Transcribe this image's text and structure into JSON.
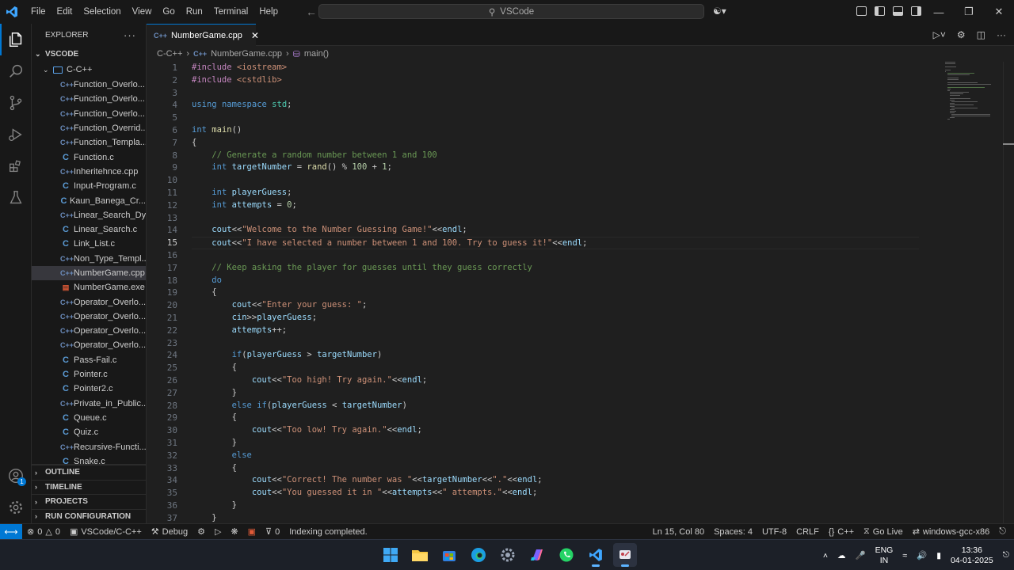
{
  "titlebar": {
    "menu": [
      "File",
      "Edit",
      "Selection",
      "View",
      "Go",
      "Run",
      "Terminal",
      "Help"
    ],
    "search_text": "VSCode"
  },
  "sidebar": {
    "title": "EXPLORER",
    "root": "VSCODE",
    "folder": "C-C++",
    "files": [
      {
        "icon": "cpp",
        "name": "Function_Overlo..."
      },
      {
        "icon": "cpp",
        "name": "Function_Overlo..."
      },
      {
        "icon": "cpp",
        "name": "Function_Overlo..."
      },
      {
        "icon": "cpp",
        "name": "Function_Overrid..."
      },
      {
        "icon": "cpp",
        "name": "Function_Templa..."
      },
      {
        "icon": "c",
        "name": "Function.c"
      },
      {
        "icon": "cpp",
        "name": "Inheritehnce.cpp"
      },
      {
        "icon": "c",
        "name": "Input-Program.c"
      },
      {
        "icon": "c",
        "name": "Kaun_Banega_Cr..."
      },
      {
        "icon": "cpp",
        "name": "Linear_Search_Dy..."
      },
      {
        "icon": "c",
        "name": "Linear_Search.c"
      },
      {
        "icon": "c",
        "name": "Link_List.c"
      },
      {
        "icon": "cpp",
        "name": "Non_Type_Templ..."
      },
      {
        "icon": "cpp",
        "name": "NumberGame.cpp",
        "selected": true
      },
      {
        "icon": "exe",
        "name": "NumberGame.exe"
      },
      {
        "icon": "cpp",
        "name": "Operator_Overlo..."
      },
      {
        "icon": "cpp",
        "name": "Operator_Overlo..."
      },
      {
        "icon": "cpp",
        "name": "Operator_Overlo..."
      },
      {
        "icon": "cpp",
        "name": "Operator_Overlo..."
      },
      {
        "icon": "c",
        "name": "Pass-Fail.c"
      },
      {
        "icon": "c",
        "name": "Pointer.c"
      },
      {
        "icon": "c",
        "name": "Pointer2.c"
      },
      {
        "icon": "cpp",
        "name": "Private_in_Public..."
      },
      {
        "icon": "c",
        "name": "Queue.c"
      },
      {
        "icon": "c",
        "name": "Quiz.c"
      },
      {
        "icon": "cpp",
        "name": "Recursive-Functi..."
      },
      {
        "icon": "c",
        "name": "Snake.c"
      }
    ],
    "sections": [
      "OUTLINE",
      "TIMELINE",
      "PROJECTS",
      "RUN CONFIGURATION"
    ]
  },
  "editor": {
    "tab": "NumberGame.cpp",
    "breadcrumb": [
      "C-C++",
      "NumberGame.cpp",
      "main()"
    ],
    "current_line": 15,
    "lines": [
      "#include <iostream>",
      "#include <cstdlib>",
      "",
      "using namespace std;",
      "",
      "int main()",
      "{",
      "    // Generate a random number between 1 and 100",
      "    int targetNumber = rand() % 100 + 1;",
      "",
      "    int playerGuess;",
      "    int attempts = 0;",
      "",
      "    cout<<\"Welcome to the Number Guessing Game!\"<<endl;",
      "    cout<<\"I have selected a number between 1 and 100. Try to guess it!\"<<endl;",
      "",
      "    // Keep asking the player for guesses until they guess correctly",
      "    do",
      "    {",
      "        cout<<\"Enter your guess: \";",
      "        cin>>playerGuess;",
      "        attempts++;",
      "",
      "        if(playerGuess > targetNumber)",
      "        {",
      "            cout<<\"Too high! Try again.\"<<endl;",
      "        }",
      "        else if(playerGuess < targetNumber)",
      "        {",
      "            cout<<\"Too low! Try again.\"<<endl;",
      "        }",
      "        else",
      "        {",
      "            cout<<\"Correct! The number was \"<<targetNumber<<\".\"<<endl;",
      "            cout<<\"You guessed it in \"<<attempts<<\" attempts.\"<<endl;",
      "        }",
      "    }"
    ]
  },
  "status": {
    "errors": "0",
    "warnings": "0",
    "folder": "VSCode/C-C++",
    "debug": "Debug",
    "ports": "0",
    "message": "Indexing completed.",
    "position": "Ln 15, Col 80",
    "spaces": "Spaces: 4",
    "encoding": "UTF-8",
    "eol": "CRLF",
    "language": "C++",
    "golive": "Go Live",
    "compiler": "windows-gcc-x86",
    "accounts_badge": "1"
  },
  "taskbar": {
    "lang1": "ENG",
    "lang2": "IN",
    "time": "13:36",
    "date": "04-01-2025"
  },
  "colors": {
    "accent": "#0078d4",
    "background": "#1f1f1f",
    "sidebar": "#181818"
  }
}
